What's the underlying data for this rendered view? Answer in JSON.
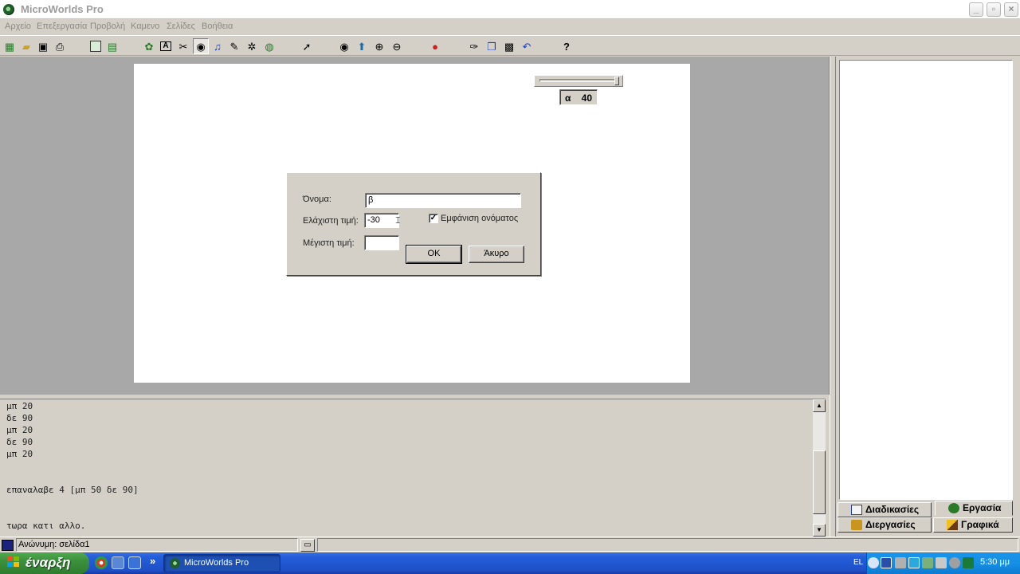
{
  "window": {
    "title": "MicroWorlds Pro",
    "controls": [
      "_",
      "▫",
      "×"
    ]
  },
  "menu": [
    "Αρχείο",
    "Επεξεργασία",
    "Προβολή",
    "Καμενο",
    "Σελίδες",
    "Βοήθεια"
  ],
  "toolbar": [
    {
      "icon": "new-file-icon",
      "glyph": "▦"
    },
    {
      "icon": "open-folder-icon",
      "glyph": "📂"
    },
    {
      "icon": "save-icon",
      "glyph": "💾"
    },
    {
      "icon": "print-icon",
      "glyph": "🖶"
    },
    {
      "icon": "page-view-icon",
      "glyph": "▣"
    },
    {
      "icon": "list-view-icon",
      "glyph": "▤"
    },
    {
      "icon": "hatch-turtle-icon",
      "glyph": "🐢"
    },
    {
      "icon": "text-box-icon",
      "glyph": "A"
    },
    {
      "icon": "button-tool-icon",
      "glyph": "✂"
    },
    {
      "icon": "slider-tool-icon",
      "glyph": "👁"
    },
    {
      "icon": "music-icon",
      "glyph": "♫"
    },
    {
      "icon": "paint-brush-icon",
      "glyph": "✎"
    },
    {
      "icon": "video-icon",
      "glyph": "🎞"
    },
    {
      "icon": "record-icon",
      "glyph": "●"
    },
    {
      "icon": "pointer-icon",
      "glyph": "↖"
    },
    {
      "icon": "eye-icon",
      "glyph": "◉"
    },
    {
      "icon": "stamp-icon",
      "glyph": "⛭"
    },
    {
      "icon": "zoom-in-icon",
      "glyph": "⊕"
    },
    {
      "icon": "zoom-out-icon",
      "glyph": "⊖"
    },
    {
      "icon": "stop-icon",
      "glyph": "✋"
    },
    {
      "icon": "cut-icon",
      "glyph": "✂"
    },
    {
      "icon": "copy-icon",
      "glyph": "⎘"
    },
    {
      "icon": "paste-icon",
      "glyph": "📋"
    },
    {
      "icon": "undo-icon",
      "glyph": "↶"
    },
    {
      "icon": "help-icon",
      "glyph": "?"
    }
  ],
  "slider": {
    "name": "α",
    "value": "40"
  },
  "dialog": {
    "name_label": "Όνομα:",
    "name_value": "β",
    "min_label": "Ελάχιστη τιμή:",
    "min_value": "-30",
    "max_label": "Μέγιστη τιμή:",
    "max_value": "",
    "show_name_label": "Εμφάνιση ονόματος",
    "show_name_checked": true,
    "ok_label": "OK",
    "cancel_label": "Άκυρο"
  },
  "command_center": {
    "lines": [
      "μπ 20",
      "δε 90",
      "μπ 20",
      "δε 90",
      "μπ 20",
      "",
      "",
      "επαναλαβε 4 [μπ 50 δε 90]",
      "",
      "",
      "τωρα κατι αλλο."
    ]
  },
  "tabs": {
    "procedures": "Διαδικασίες",
    "project": "Εργασία",
    "processes": "Διεργασίες",
    "graphics": "Γραφικά"
  },
  "status": {
    "text": "Ανώνυμη: σελίδα1"
  },
  "taskbar": {
    "start_label": "έναρξη",
    "task_label": "MicroWorlds Pro",
    "lang": "EL",
    "clock": "5:30 μμ",
    "overflow": "»"
  }
}
